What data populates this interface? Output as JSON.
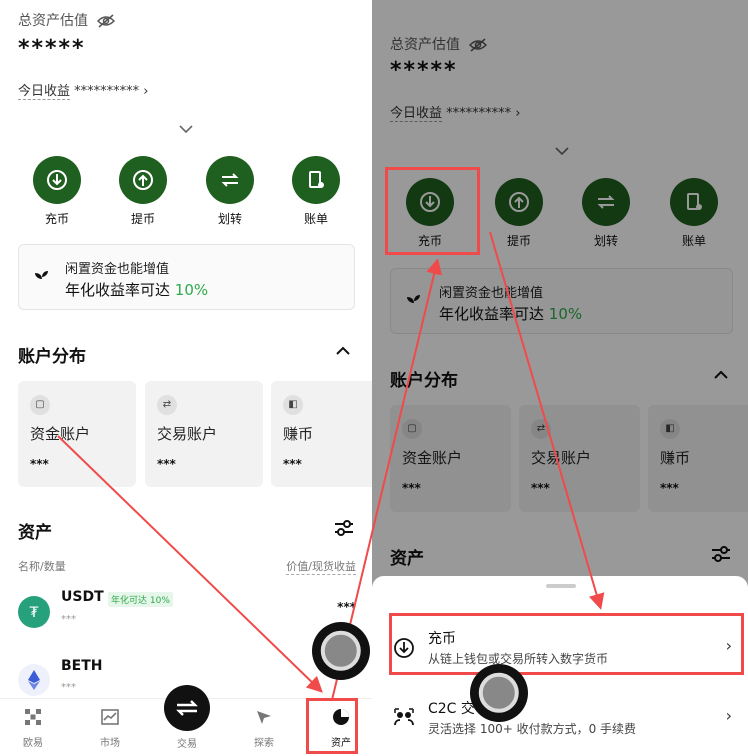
{
  "left": {
    "total_label": "总资产估值",
    "total_value": "*****",
    "today_label": "今日收益",
    "today_value": "**********",
    "actions": [
      "充币",
      "提币",
      "划转",
      "账单"
    ],
    "promo": {
      "line1": "闲置资金也能增值",
      "line2_prefix": "年化收益率可达",
      "line2_rate": "10%"
    },
    "accounts_title": "账户分布",
    "accounts": [
      {
        "name": "资金账户",
        "value": "***"
      },
      {
        "name": "交易账户",
        "value": "***"
      },
      {
        "name": "赚币",
        "value": "***"
      }
    ],
    "assets_title": "资产",
    "col_left": "名称/数量",
    "col_right": "价值/现货收益",
    "coins": [
      {
        "name": "USDT",
        "badge": "年化可达 10%",
        "amount": "***",
        "value": "***"
      },
      {
        "name": "BETH",
        "amount": "***"
      }
    ],
    "nav": [
      "欧易",
      "市场",
      "交易",
      "探索",
      "资产"
    ]
  },
  "right": {
    "total_label": "总资产估值",
    "total_value": "*****",
    "today_label": "今日收益",
    "today_value": "**********",
    "actions": [
      "充币",
      "提币",
      "划转",
      "账单"
    ],
    "promo": {
      "line1": "闲置资金也能增值",
      "line2_prefix": "年化收益率可达",
      "line2_rate": "10%"
    },
    "accounts_title": "账户分布",
    "accounts": [
      {
        "name": "资金账户",
        "value": "***"
      },
      {
        "name": "交易账户",
        "value": "***"
      },
      {
        "name": "赚币",
        "value": "***"
      }
    ],
    "assets_title": "资产",
    "sheet": [
      {
        "title": "充币",
        "desc": "从链上钱包或交易所转入数字货币"
      },
      {
        "title": "C2C 交",
        "desc": "灵活选择 100+ 收付款方式，0 手续费"
      }
    ]
  },
  "colors": {
    "brand_green": "#1f5f1f",
    "accent_green": "#2eaa4a",
    "annotation_red": "#f04a4a"
  }
}
